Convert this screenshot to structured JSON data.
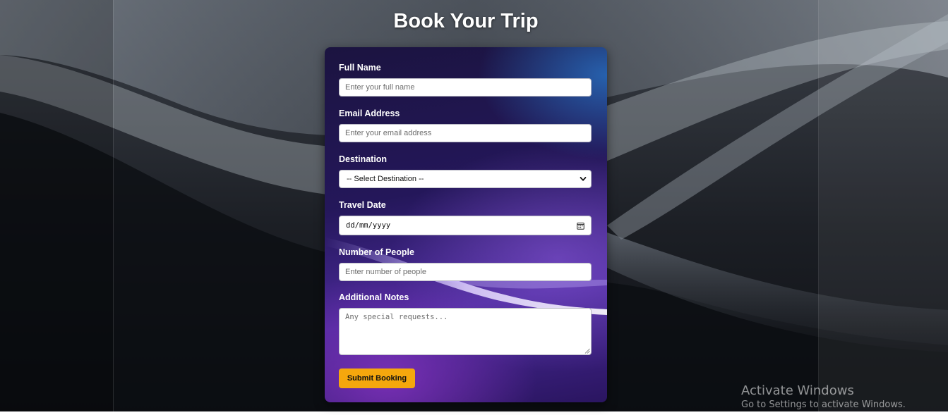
{
  "page": {
    "title": "Book Your Trip"
  },
  "form": {
    "full_name": {
      "label": "Full Name",
      "placeholder": "Enter your full name",
      "value": ""
    },
    "email": {
      "label": "Email Address",
      "placeholder": "Enter your email address",
      "value": ""
    },
    "destination": {
      "label": "Destination",
      "selected": "-- Select Destination --",
      "icon": "chevron-down-icon"
    },
    "travel_date": {
      "label": "Travel Date",
      "value": "dd/mm/yyyy",
      "icon": "calendar-icon"
    },
    "people": {
      "label": "Number of People",
      "placeholder": "Enter number of people",
      "value": ""
    },
    "notes": {
      "label": "Additional Notes",
      "placeholder": "Any special requests...",
      "value": ""
    },
    "submit_label": "Submit Booking"
  },
  "watermark": {
    "title": "Activate Windows",
    "subtitle": "Go to Settings to activate Windows."
  },
  "colors": {
    "submit_button": "#f5a70d",
    "card_base": "#24175a",
    "input_background": "#ffffff",
    "title_text": "#ffffff"
  }
}
